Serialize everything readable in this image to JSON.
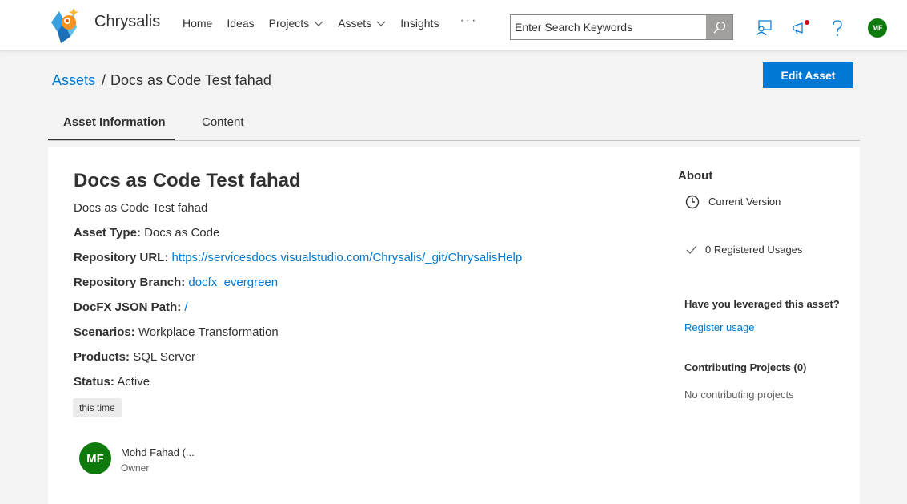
{
  "header": {
    "brand": "Chrysalis",
    "nav": [
      {
        "label": "Home"
      },
      {
        "label": "Ideas"
      },
      {
        "label": "Projects"
      },
      {
        "label": "Assets"
      },
      {
        "label": "Insights"
      }
    ],
    "more": "···",
    "search_placeholder": "Enter Search Keywords",
    "user_initials": "MF"
  },
  "breadcrumb": {
    "parent": "Assets",
    "separator": "/",
    "current": "Docs as Code Test fahad"
  },
  "edit_button": "Edit Asset",
  "tabs": [
    {
      "label": "Asset Information",
      "active": true
    },
    {
      "label": "Content",
      "active": false
    }
  ],
  "asset": {
    "title": "Docs as Code Test fahad",
    "description": "Docs as Code Test fahad",
    "fields": {
      "type_label": "Asset Type:",
      "type_value": "Docs as Code",
      "repo_url_label": "Repository URL:",
      "repo_url_value": "https://servicesdocs.visualstudio.com/Chrysalis/_git/ChrysalisHelp",
      "repo_branch_label": "Repository Branch:",
      "repo_branch_value": "docfx_evergreen",
      "docfx_label": "DocFX JSON Path:",
      "docfx_value": "/",
      "scenarios_label": "Scenarios:",
      "scenarios_value": "Workplace Transformation",
      "products_label": "Products:",
      "products_value": "SQL Server",
      "status_label": "Status:",
      "status_value": "Active"
    },
    "tag": "this time",
    "owner": {
      "initials": "MF",
      "name": "Mohd Fahad (...",
      "role": "Owner"
    }
  },
  "about": {
    "title": "About",
    "version": "Current Version",
    "usages": "0 Registered Usages",
    "leverage_q": "Have you leveraged this asset?",
    "register": "Register usage",
    "contrib_title": "Contributing Projects (0)",
    "contrib_empty": "No contributing projects"
  },
  "colors": {
    "accent": "#0078d4",
    "avatar": "#0e7a0d",
    "notification_dot": "#c50f1f"
  }
}
